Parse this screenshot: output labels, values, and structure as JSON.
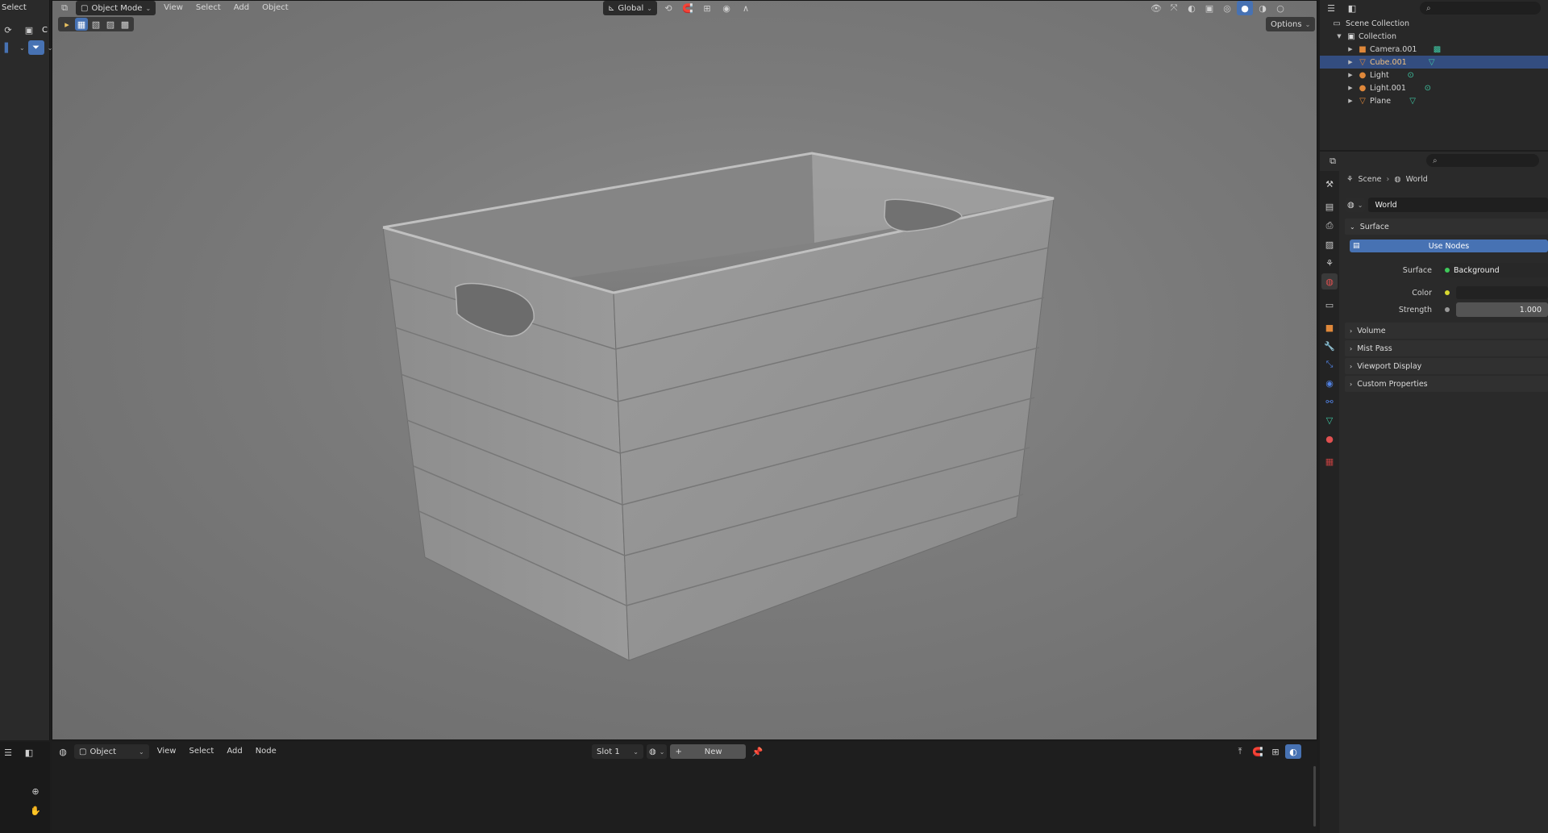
{
  "viewport_header": {
    "mode": "Object Mode",
    "menus": [
      "View",
      "Select",
      "Add",
      "Object"
    ],
    "transform_orientation": "Global",
    "options_label": "Options"
  },
  "left_panel": {
    "top_label": "Select",
    "sub_label": "C"
  },
  "outliner": {
    "root": "Scene Collection",
    "collection": "Collection",
    "items": [
      {
        "name": "Camera.001",
        "icon": "camera-icon",
        "selected": false
      },
      {
        "name": "Cube.001",
        "icon": "mesh-icon",
        "selected": true
      },
      {
        "name": "Light",
        "icon": "light-icon",
        "selected": false
      },
      {
        "name": "Light.001",
        "icon": "light-icon",
        "selected": false
      },
      {
        "name": "Plane",
        "icon": "mesh-icon",
        "selected": false
      }
    ]
  },
  "properties": {
    "breadcrumb_scene": "Scene",
    "breadcrumb_world": "World",
    "world_name": "World",
    "surface_header": "Surface",
    "use_nodes_label": "Use Nodes",
    "surface_label": "Surface",
    "surface_value": "Background",
    "color_label": "Color",
    "strength_label": "Strength",
    "strength_value": "1.000",
    "collapsed_panels": [
      "Volume",
      "Mist Pass",
      "Viewport Display",
      "Custom Properties"
    ]
  },
  "node_editor": {
    "mode": "Object",
    "menus": [
      "View",
      "Select",
      "Add",
      "Node"
    ],
    "slot": "Slot 1",
    "new_label": "New"
  },
  "colors": {
    "accent": "#4772b3",
    "selected_row": "#334d80",
    "mesh_icon": "#3fc9a5",
    "object_icon": "#e0883a"
  }
}
